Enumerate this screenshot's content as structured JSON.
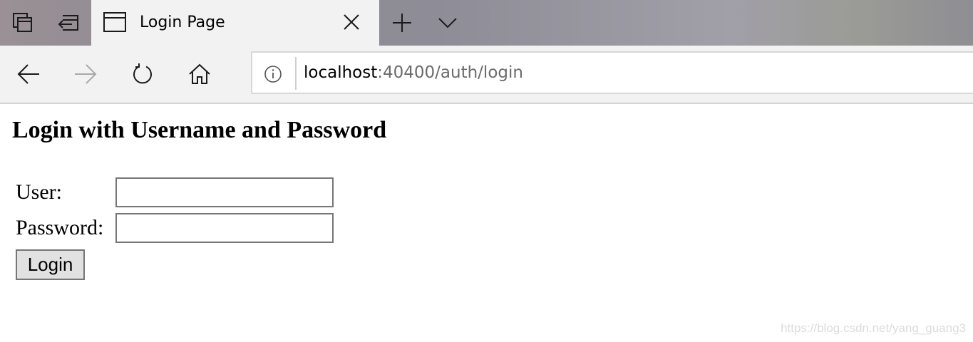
{
  "browser": {
    "tab": {
      "title": "Login Page"
    },
    "address": {
      "host": "localhost",
      "path": ":40400/auth/login"
    },
    "icons": {
      "tab_manager": "tab-manager-icon",
      "set_aside": "set-aside-tabs-icon",
      "tab_page": "page-icon",
      "close": "close-icon",
      "new_tab": "plus-icon",
      "tab_list": "chevron-down-icon",
      "back": "back-arrow-icon",
      "forward": "forward-arrow-icon",
      "refresh": "refresh-icon",
      "home": "home-icon",
      "info": "info-icon"
    }
  },
  "page": {
    "heading": "Login with Username and Password",
    "form": {
      "user_label": "User:",
      "user_value": "",
      "password_label": "Password:",
      "password_value": "",
      "submit_label": "Login"
    },
    "watermark": "https://blog.csdn.net/yang_guang3"
  },
  "colors": {
    "tab_bg": "#f2f2f2",
    "button_bg": "#e1e1e1",
    "input_border": "#767676",
    "url_path": "#6b6b6b"
  }
}
